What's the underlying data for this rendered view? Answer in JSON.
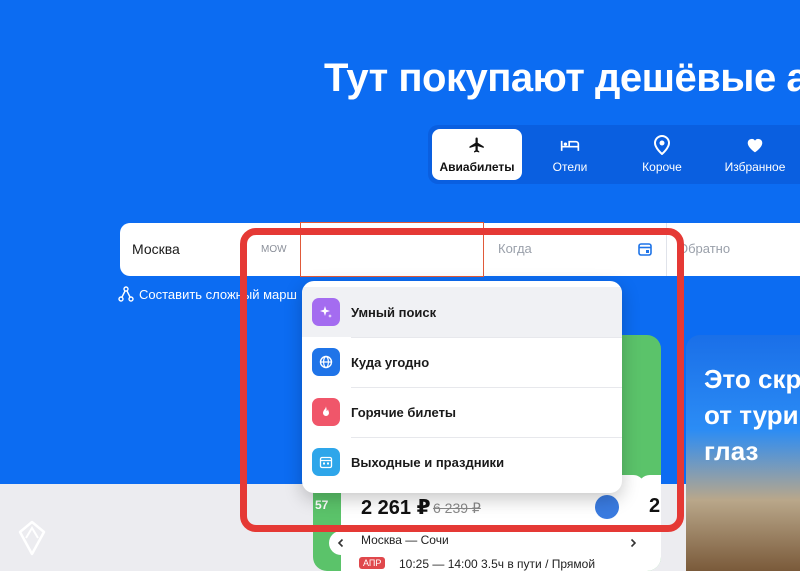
{
  "headline": "Тут покупают дешёвые а",
  "tabs": [
    {
      "label": "Авиабилеты",
      "icon": "plane-icon",
      "active": true
    },
    {
      "label": "Отели",
      "icon": "bed-icon",
      "active": false
    },
    {
      "label": "Короче",
      "icon": "pin-icon",
      "active": false
    },
    {
      "label": "Избранное",
      "icon": "heart-icon",
      "active": false
    }
  ],
  "search": {
    "from": "Москва",
    "from_code": "MOW",
    "to": "",
    "when_placeholder": "Когда",
    "back_placeholder": "Обратно"
  },
  "complex_route": "Составить сложный марш",
  "dropdown": [
    {
      "label": "Умный поиск",
      "icon": "sparkle-icon",
      "color": "#a46cf0"
    },
    {
      "label": "Куда угодно",
      "icon": "globe-icon",
      "color": "#1f74e8"
    },
    {
      "label": "Горячие билеты",
      "icon": "fire-icon",
      "color": "#f0566a"
    },
    {
      "label": "Выходные и праздники",
      "icon": "calendar-icon",
      "color": "#2ea6ea"
    }
  ],
  "deal_card": {
    "badge": "57",
    "price": "2 261 ₽",
    "old_price": "6 239 ₽",
    "second_price": "2",
    "route": "Москва — Сочи",
    "month": "АПР",
    "times": "10:25 — 14:00   3.5ч в пути / Прямой"
  },
  "promo": {
    "text": "Это скр\nот тури\nглаз"
  },
  "colors": {
    "brand": "#0c6cf2",
    "highlight": "#e53935",
    "deal_bg": "#5bc36a"
  }
}
